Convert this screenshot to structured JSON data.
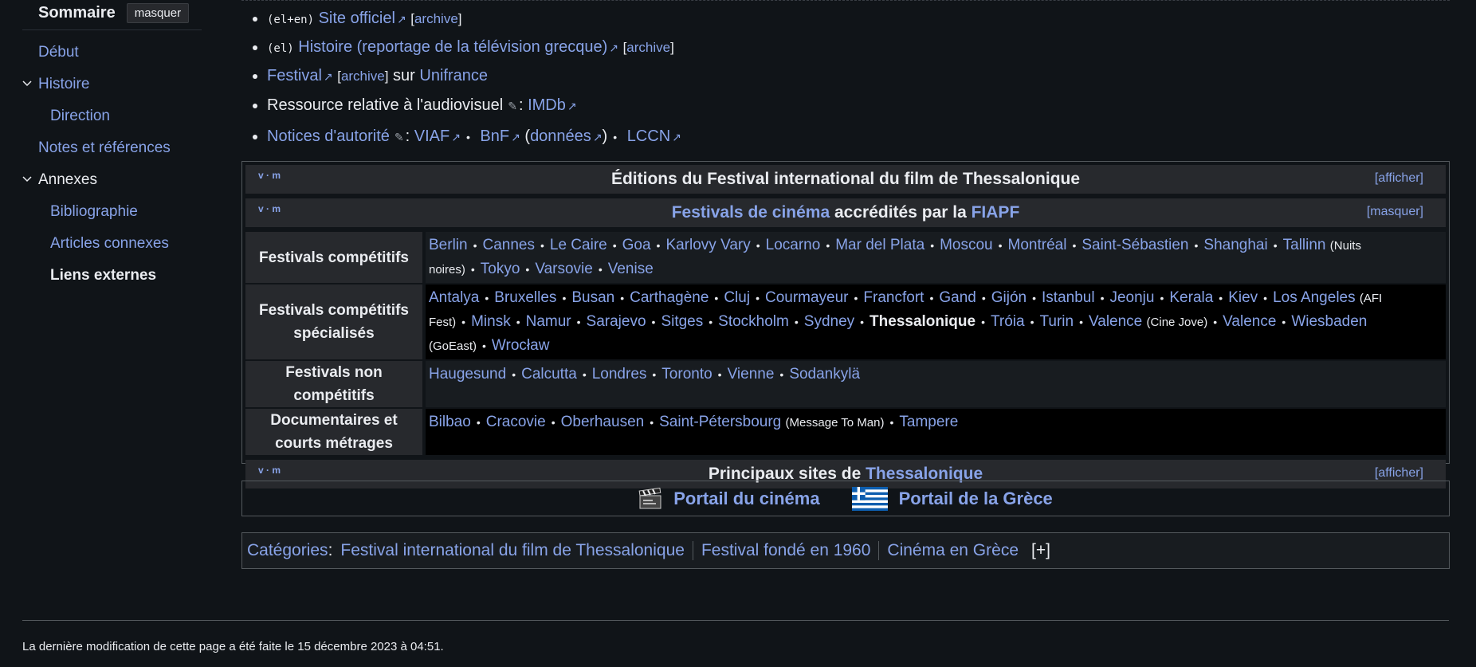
{
  "toc": {
    "title": "Sommaire",
    "hide_label": "masquer",
    "items": [
      {
        "label": "Début",
        "level": 1
      },
      {
        "label": "Histoire",
        "level": 1,
        "expanded": true
      },
      {
        "label": "Direction",
        "level": 2
      },
      {
        "label": "Notes et références",
        "level": 1
      },
      {
        "label": "Annexes",
        "level": 1,
        "expanded": true
      },
      {
        "label": "Bibliographie",
        "level": 2
      },
      {
        "label": "Articles connexes",
        "level": 2
      },
      {
        "label": "Liens externes",
        "level": 2,
        "active": true
      }
    ]
  },
  "external_links": {
    "item1": {
      "lang": "(el+en)",
      "link": "Site officiel",
      "archive": "archive"
    },
    "item2": {
      "lang": "(el)",
      "link": "Histoire (reportage de la télévision grecque)",
      "archive": "archive"
    },
    "item3": {
      "link": "Festival",
      "archive": "archive",
      "text": "sur",
      "link2": "Unifrance"
    },
    "item4": {
      "text": "Ressource relative à l'audiovisuel",
      "colon": ":",
      "link": "IMDb"
    },
    "item5": {
      "link": "Notices d'autorité",
      "colon": ":",
      "viaf": "VIAF",
      "bnf": "BnF",
      "donnees": "données",
      "lccn": "LCCN"
    }
  },
  "navbox": {
    "vm": "v · m",
    "editions": {
      "title": "Éditions du Festival international du film de Thessalonique",
      "toggle": "[afficher]"
    },
    "festivals": {
      "title_link": "Festivals de cinéma",
      "title_text": "accrédités par la",
      "title_link2": "FIAPF",
      "toggle": "[masquer]",
      "rows": [
        {
          "group": "Festivals compétitifs",
          "items": [
            "Berlin",
            "Cannes",
            "Le Caire",
            "Goa",
            "Karlovy Vary",
            "Locarno",
            "Mar del Plata",
            "Moscou",
            "Montréal",
            "Saint-Sébastien",
            "Shanghai",
            "Tallinn",
            "Tokyo",
            "Varsovie",
            "Venise"
          ],
          "notes": {
            "Tallinn": "(Nuits noires)"
          }
        },
        {
          "group": "Festivals compétitifs spécialisés",
          "items": [
            "Antalya",
            "Bruxelles",
            "Busan",
            "Carthagène",
            "Cluj",
            "Courmayeur",
            "Francfort",
            "Gand",
            "Gijón",
            "Istanbul",
            "Jeonju",
            "Kerala",
            "Kiev",
            "Los Angeles",
            "Minsk",
            "Namur",
            "Sarajevo",
            "Sitges",
            "Stockholm",
            "Sydney",
            "Thessalonique",
            "Tróia",
            "Turin",
            "Valence",
            "Valence",
            "Wiesbaden",
            "Wrocław"
          ],
          "notes": {
            "Los Angeles": "(AFI Fest)",
            "Valence": "(Cine Jove)",
            "Wiesbaden": "(GoEast)"
          },
          "self": "Thessalonique"
        },
        {
          "group": "Festivals non compétitifs",
          "items": [
            "Haugesund",
            "Calcutta",
            "Londres",
            "Toronto",
            "Vienne",
            "Sodankylä"
          ],
          "notes": {}
        },
        {
          "group": "Documentaires et courts métrages",
          "items": [
            "Bilbao",
            "Cracovie",
            "Oberhausen",
            "Saint-Pétersbourg",
            "Tampere"
          ],
          "notes": {
            "Saint-Pétersbourg": "(Message To Man)"
          }
        }
      ]
    },
    "sites": {
      "title_text": "Principaux sites de",
      "title_link": "Thessalonique",
      "toggle": "[afficher]"
    }
  },
  "portals": [
    {
      "label": "Portail du cinéma",
      "icon": "clapperboard-icon"
    },
    {
      "label": "Portail de la Grèce",
      "icon": "greece-flag-icon"
    }
  ],
  "categories": {
    "label": "Catégories",
    "colon": ":",
    "items": [
      "Festival international du film de Thessalonique",
      "Festival fondé en 1960",
      "Cinéma en Grèce"
    ],
    "expand": "[+]"
  },
  "footer": {
    "last_modified": "La dernière modification de cette page a été faite le 15 décembre 2023 à 04:51."
  },
  "colors": {
    "link": "#88a3e8",
    "background": "#101418",
    "text": "#eaecf0"
  }
}
